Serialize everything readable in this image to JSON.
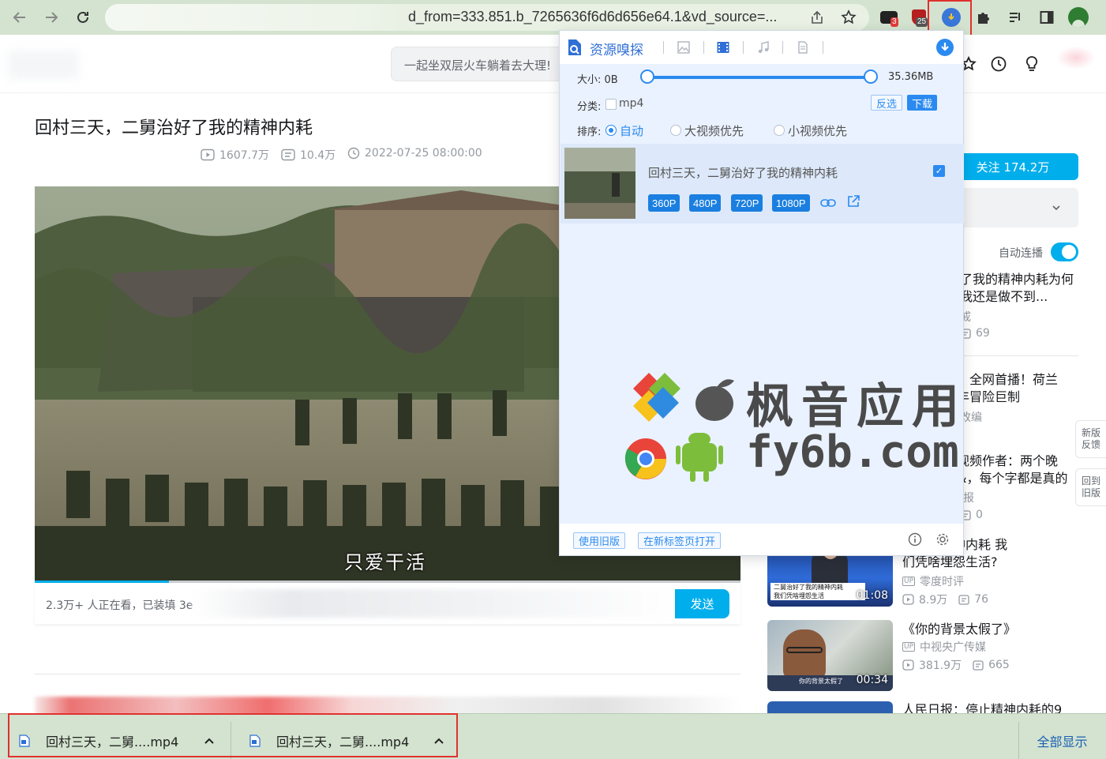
{
  "browser": {
    "url_visible": "d_from=333.851.b_7265636f6d6d656e64.1&vd_source=...",
    "ext_badges": [
      "3",
      "25"
    ]
  },
  "page": {
    "search_placeholder": "一起坐双层火车躺着去大理!",
    "video_title": "回村三天，二舅治好了我的精神内耗",
    "views": "1607.7万",
    "danmaku_count": "10.4万",
    "publish_time": "2022-07-25 08:00:00",
    "subtitle": "只爱干活",
    "progress": 0.19,
    "watching_text": "2.3万+ 人正在看，已装填 3e",
    "send_label": "发送"
  },
  "sidebar": {
    "follow_label": "关注 174.2万",
    "autoplay_label": "自动连播",
    "side_tabs": [
      "新版\n反馈",
      "回到\n旧版"
    ],
    "items": [
      {
        "title": "了我的精神内耗为何\n我还是做不到...",
        "author": "戒",
        "danmaku": "69"
      },
      {
        "title": "》全网首播！荷兰\n丰冒险巨制",
        "author": "改编"
      },
      {
        "title": "视频作者：两个晚\n&，每个字都是真的",
        "author": "报",
        "danmaku": "0"
      },
      {
        "title": "了我的精神内耗 我\n们凭啥埋怨生活?",
        "author": "零度时评",
        "views": "8.9万",
        "danmaku": "76",
        "duration": "01:08",
        "thumb_caption": "二舅治好了我的精神内耗\n我们凭啥埋怨生活"
      },
      {
        "title": "《你的背景太假了》",
        "author": "中视央广传媒",
        "views": "381.9万",
        "danmaku": "665",
        "duration": "00:34",
        "thumb_caption": "你的背景太假了"
      },
      {
        "title": "人民日报：停止精神内耗的9"
      }
    ]
  },
  "popup": {
    "title": "资源嗅探",
    "size_label": "大小: 0B",
    "size_max": "35.36MB",
    "category_label": "分类:",
    "category_option": "mp4",
    "invert_label": "反选",
    "download_label": "下载",
    "sort_label": "排序:",
    "sort_options": [
      "自动",
      "大视频优先",
      "小视频优先"
    ],
    "resource": {
      "title": "回村三天，二舅治好了我的精神内耗",
      "qualities": [
        "360P",
        "480P",
        "720P",
        "1080P"
      ]
    },
    "footer": {
      "old_version": "使用旧版",
      "open_in_tab": "在新标签页打开"
    }
  },
  "watermark": {
    "line1": "枫音应用",
    "line2": "fy6b.com"
  },
  "downloads": {
    "items": [
      "回村三天，二舅....mp4",
      "回村三天，二舅....mp4"
    ],
    "show_all": "全部显示"
  },
  "colors": {
    "bili_blue": "#00aeec",
    "popup_blue": "#2b8af0",
    "browser_chrome": "#d3e3cf",
    "highlight_red": "#e0312f"
  }
}
